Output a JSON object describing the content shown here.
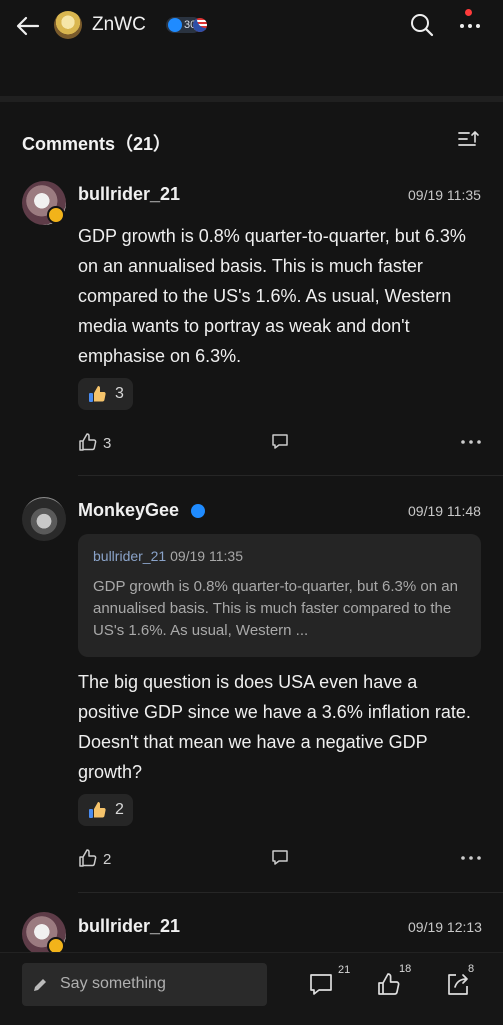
{
  "header": {
    "username": "ZnWC",
    "level": "30"
  },
  "comments_section": {
    "title": "Comments（21）"
  },
  "comments": [
    {
      "user": "bullrider_21",
      "time": "09/19 11:35",
      "text": "GDP growth is 0.8% quarter-to-quarter, but 6.3% on an annualised basis. This is much faster compared to the US's 1.6%. As usual, Western media wants to portray as weak and don't emphasise on 6.3%.",
      "reaction_count": "3",
      "like_count": "3"
    },
    {
      "user": "MonkeyGee",
      "time": "09/19 11:48",
      "quote_user": "bullrider_21",
      "quote_time": "09/19 11:35",
      "quote_text": "GDP growth is 0.8% quarter-to-quarter, but 6.3% on an annualised basis. This is much faster compared to the US's 1.6%. As usual, Western ...",
      "text": "The big question is does USA even have a positive GDP since we have a 3.6% inflation rate.  Doesn't that mean we have a negative GDP growth?",
      "reaction_count": "2",
      "like_count": "2"
    },
    {
      "user": "bullrider_21",
      "time": "09/19 12:13"
    }
  ],
  "bottom_bar": {
    "placeholder": "Say something",
    "comment_count": "21",
    "like_count": "18",
    "share_count": "8"
  },
  "colors": {
    "background": "#141414",
    "verified_blue": "#1f8bff",
    "notification_red": "#ff3b3b"
  }
}
